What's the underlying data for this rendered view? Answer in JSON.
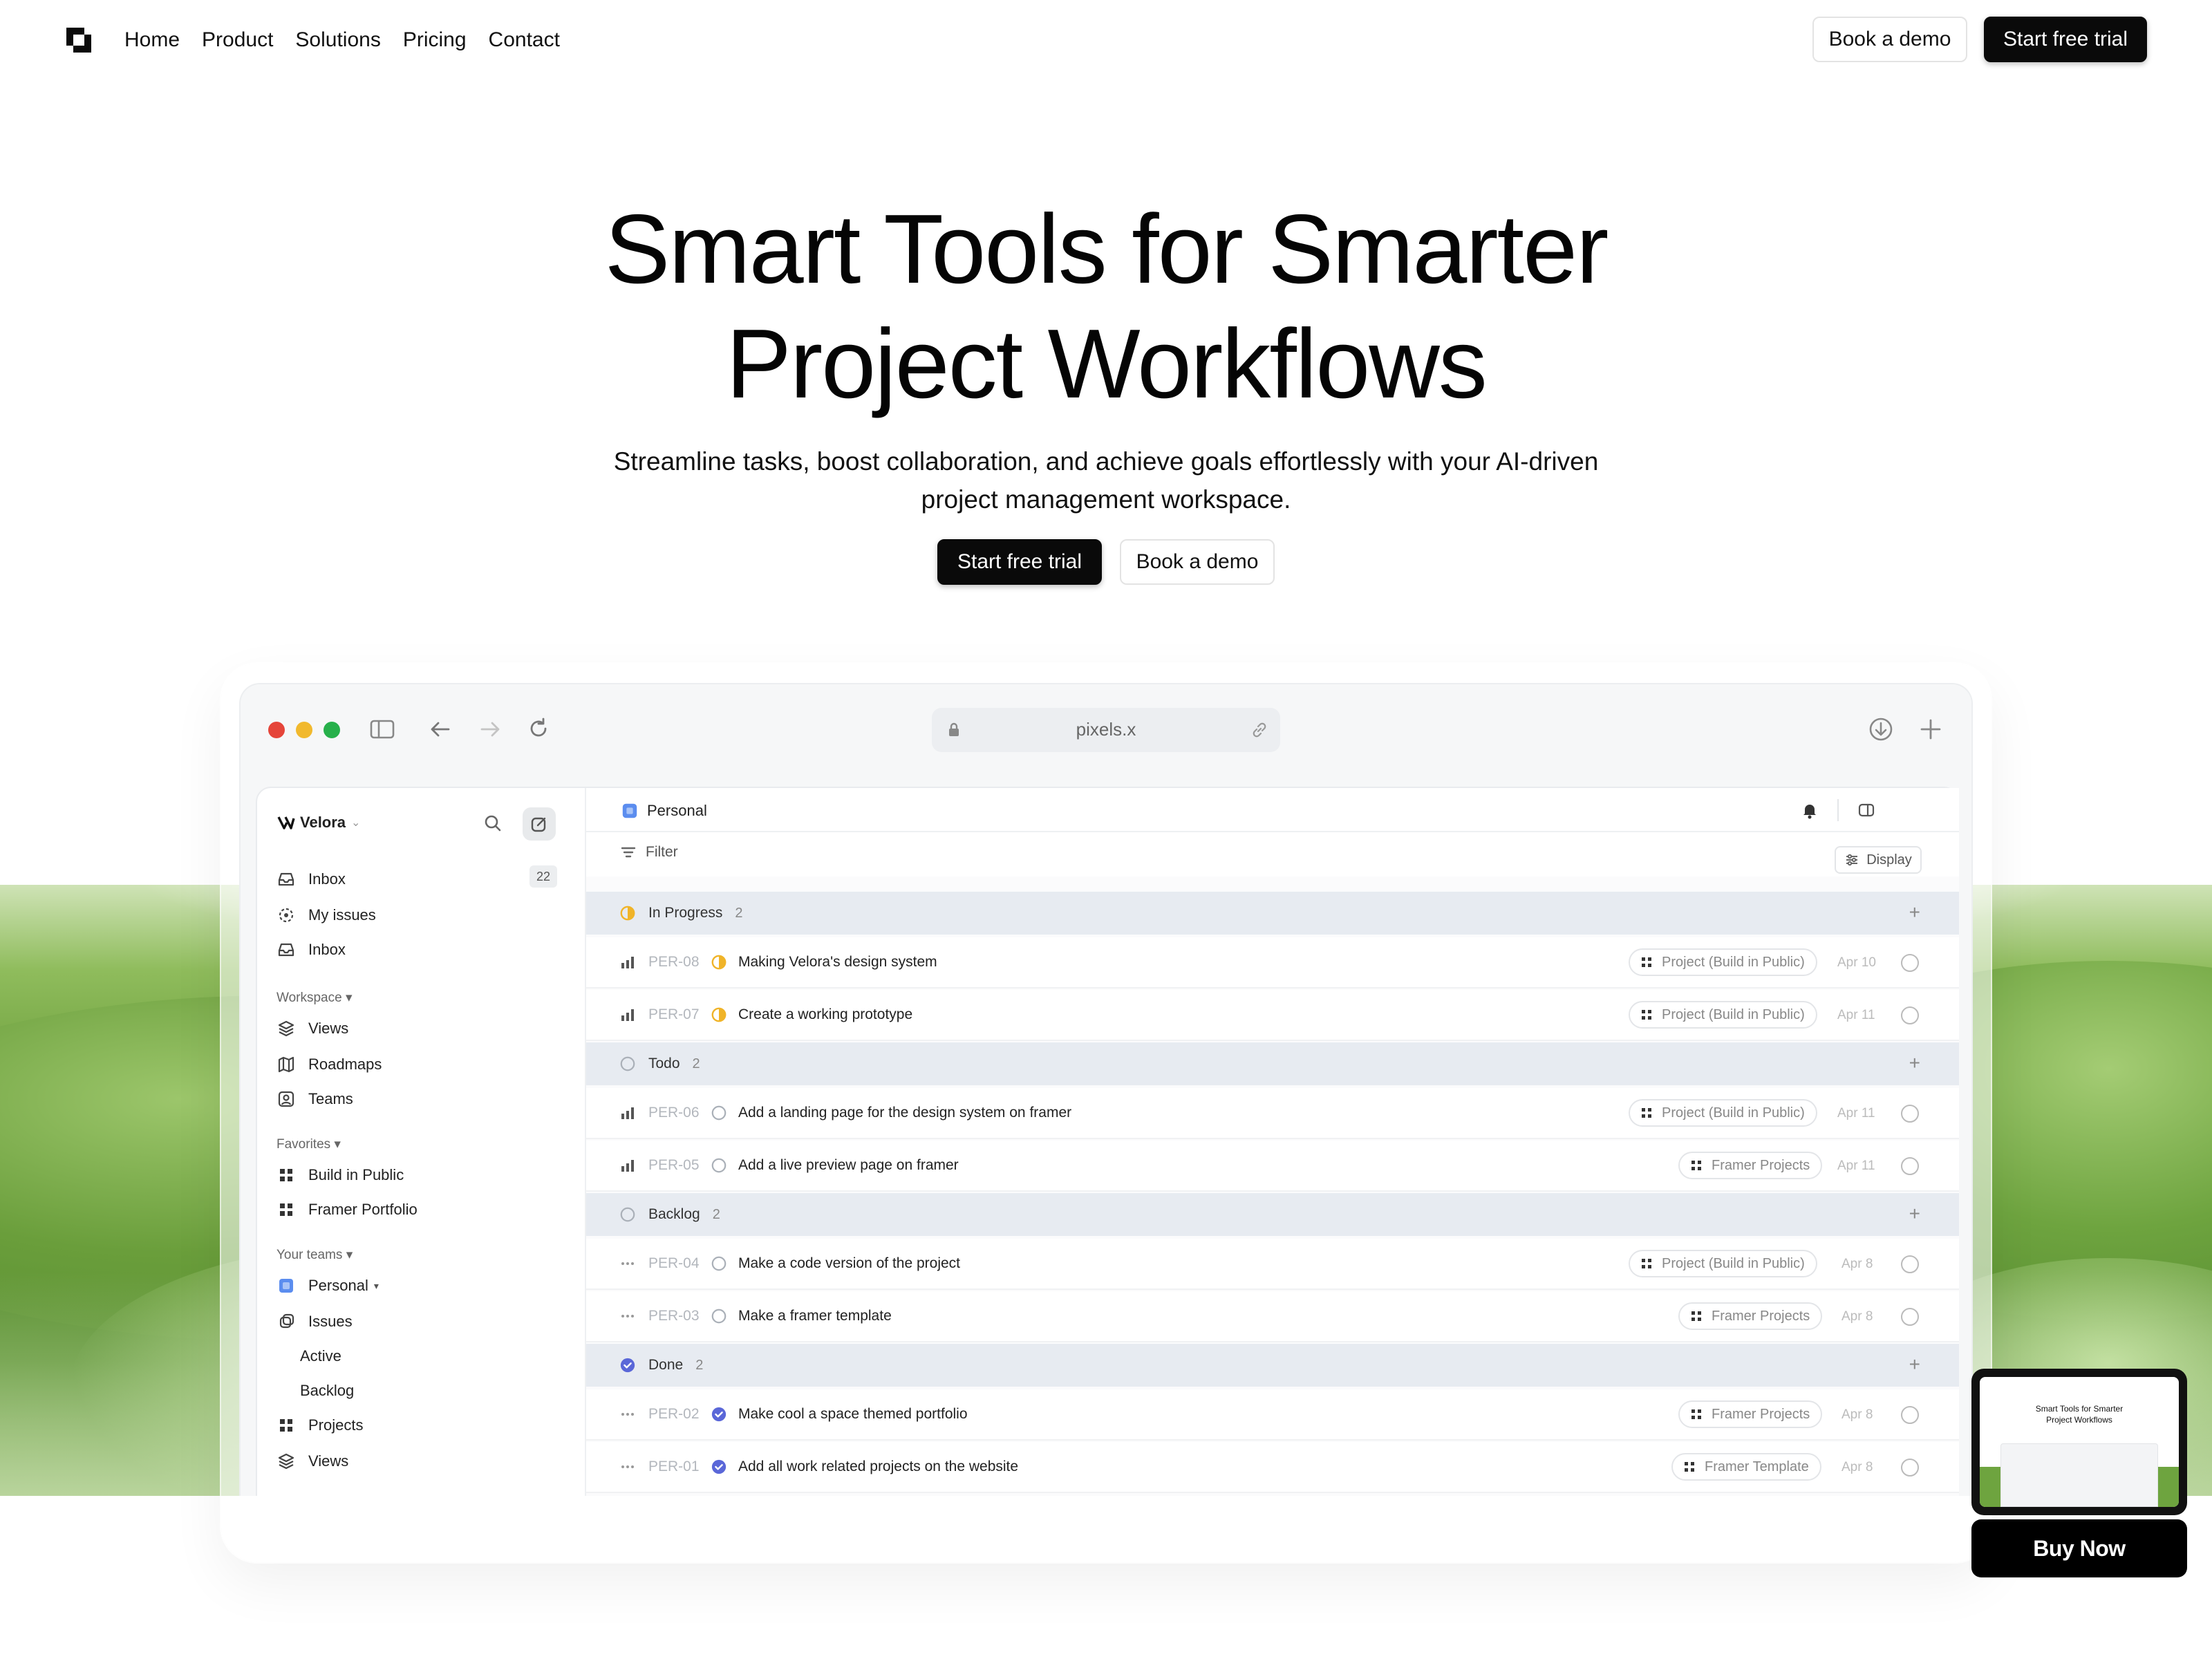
{
  "nav": {
    "links": [
      "Home",
      "Product",
      "Solutions",
      "Pricing",
      "Contact"
    ],
    "book_demo": "Book a demo",
    "start_trial": "Start free trial"
  },
  "hero": {
    "title_line1": "Smart Tools for Smarter",
    "title_line2": "Project Workflows",
    "subtitle_line1": "Streamline tasks, boost collaboration, and achieve goals effortlessly with your AI-driven",
    "subtitle_line2": "project management workspace.",
    "cta_primary": "Start free trial",
    "cta_secondary": "Book a demo"
  },
  "browser": {
    "url": "pixels.x",
    "traffic_colors": [
      "#e5453a",
      "#f1b92e",
      "#27b04b"
    ]
  },
  "app": {
    "workspace_name": "Velora",
    "sidebar": {
      "top_items": [
        {
          "label": "Inbox",
          "icon": "inbox-icon"
        },
        {
          "label": "My issues",
          "icon": "issues-icon"
        },
        {
          "label": "Inbox",
          "icon": "inbox-icon"
        }
      ],
      "inbox_count": "22",
      "workspace_heading": "Workspace",
      "workspace_items": [
        {
          "label": "Views",
          "icon": "layers-icon"
        },
        {
          "label": "Roadmaps",
          "icon": "map-icon"
        },
        {
          "label": "Teams",
          "icon": "team-icon"
        }
      ],
      "favorites_heading": "Favorites",
      "favorites_items": [
        {
          "label": "Build in Public",
          "icon": "grid-icon"
        },
        {
          "label": "Framer Portfolio",
          "icon": "grid-icon"
        }
      ],
      "teams_heading": "Your teams",
      "team_name": "Personal",
      "team_items": [
        {
          "label": "Issues",
          "icon": "issues-icon"
        },
        {
          "label": "Active",
          "icon": ""
        },
        {
          "label": "Backlog",
          "icon": ""
        },
        {
          "label": "Projects",
          "icon": "grid-icon"
        },
        {
          "label": "Views",
          "icon": "layers-icon"
        }
      ]
    },
    "main": {
      "title": "Personal",
      "filter_label": "Filter",
      "display_label": "Display",
      "groups": [
        {
          "name": "In Progress",
          "count": "2",
          "status": "in-progress",
          "rows": [
            {
              "id": "PER-08",
              "title": "Making Velora's design system",
              "tag": "Project (Build in Public)",
              "date": "Apr 10",
              "priority": "bars"
            },
            {
              "id": "PER-07",
              "title": "Create a working prototype",
              "tag": "Project (Build in Public)",
              "date": "Apr 11",
              "priority": "bars"
            }
          ]
        },
        {
          "name": "Todo",
          "count": "2",
          "status": "todo",
          "rows": [
            {
              "id": "PER-06",
              "title": "Add a landing page for the design system on framer",
              "tag": "Project (Build in Public)",
              "date": "Apr 11",
              "priority": "bars"
            },
            {
              "id": "PER-05",
              "title": "Add a live preview page on framer",
              "tag": "Framer Projects",
              "date": "Apr 11",
              "priority": "bars"
            }
          ]
        },
        {
          "name": "Backlog",
          "count": "2",
          "status": "backlog",
          "rows": [
            {
              "id": "PER-04",
              "title": "Make a code version of the project",
              "tag": "Project (Build in Public)",
              "date": "Apr 8",
              "priority": "dots"
            },
            {
              "id": "PER-03",
              "title": "Make a framer template",
              "tag": "Framer Projects",
              "date": "Apr 8",
              "priority": "dots"
            }
          ]
        },
        {
          "name": "Done",
          "count": "2",
          "status": "done",
          "rows": [
            {
              "id": "PER-02",
              "title": "Make cool a space themed portfolio",
              "tag": "Framer Projects",
              "date": "Apr 8",
              "priority": "dots"
            },
            {
              "id": "PER-01",
              "title": "Add all work related projects on the website",
              "tag": "Framer Template",
              "date": "Apr 8",
              "priority": "dots"
            }
          ]
        }
      ]
    }
  },
  "widget": {
    "preview_title_line1": "Smart Tools for Smarter",
    "preview_title_line2": "Project Workflows",
    "buy_label": "Buy Now"
  }
}
